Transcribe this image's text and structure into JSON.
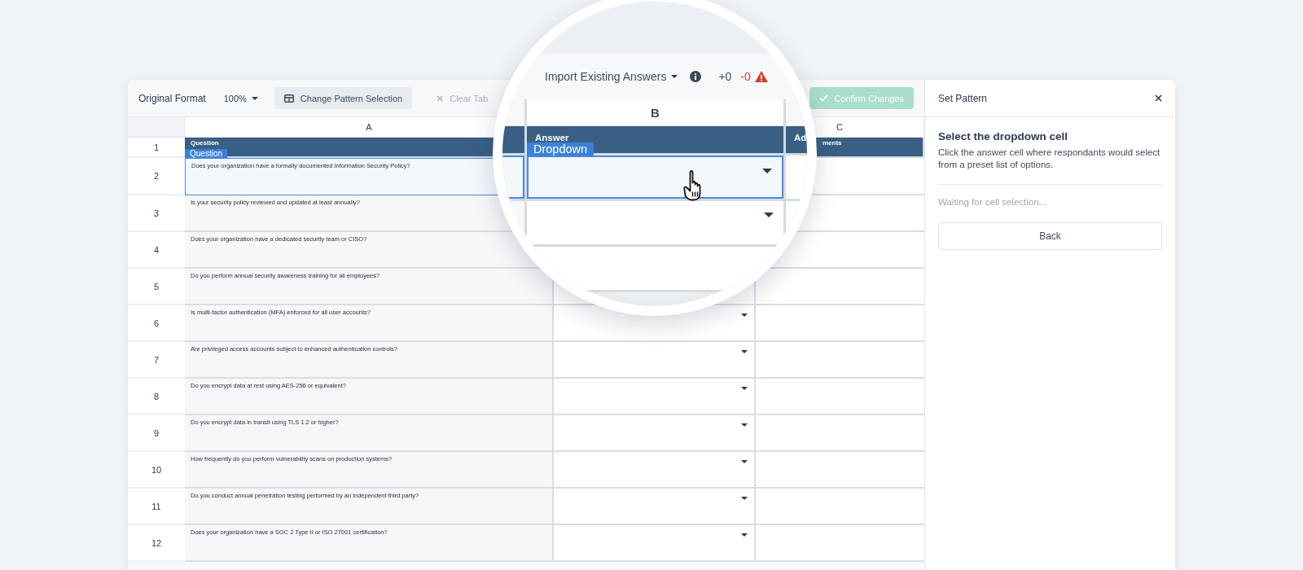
{
  "toolbar": {
    "format_label": "Original Format",
    "zoom": "100%",
    "change_pattern": "Change Pattern Selection",
    "clear_tab": "Clear Tab",
    "confirm": "Confirm Changes",
    "confirm_disabled": true,
    "clear_disabled": true
  },
  "columns": [
    "A",
    "C"
  ],
  "header_row": {
    "number": "1",
    "question_label": "Question",
    "question_tag": "Question",
    "comments_label": "ments"
  },
  "rows": [
    {
      "number": "2",
      "question": "Does your organization have a formally documented Information Security Policy?",
      "selected": true
    },
    {
      "number": "3",
      "question": "Is your security policy reviewed and updated at least annually?",
      "selected": false
    },
    {
      "number": "4",
      "question": "Does your organization have a dedicated security team or CISO?",
      "selected": false
    },
    {
      "number": "5",
      "question": "Do you perform annual security awareness training for all employees?",
      "selected": false
    },
    {
      "number": "6",
      "question": "Is multi-factor authentication (MFA) enforced for all user accounts?",
      "selected": false,
      "caret": true
    },
    {
      "number": "7",
      "question": "Are privileged access accounts subject to enhanced authentication controls?",
      "selected": false,
      "caret": true
    },
    {
      "number": "8",
      "question": "Do you encrypt data at rest using AES-256 or equivalent?",
      "selected": false,
      "caret": true
    },
    {
      "number": "9",
      "question": "Do you encrypt data in transit using TLS 1.2 or higher?",
      "selected": false,
      "caret": true
    },
    {
      "number": "10",
      "question": "How frequently do you perform vulnerability scans on production systems?",
      "selected": false,
      "caret": true
    },
    {
      "number": "11",
      "question": "Do you conduct annual penetration testing performed by an independent third party?",
      "selected": false,
      "caret": true
    },
    {
      "number": "12",
      "question": "Does your organization have a SOC 2 Type II or ISO 27001 certification?",
      "selected": false,
      "caret": true
    }
  ],
  "panel": {
    "title": "Set Pattern",
    "heading": "Select the dropdown cell",
    "description": "Click the answer cell where respondants would select from a preset list of options.",
    "status": "Waiting for cell selection...",
    "back": "Back"
  },
  "magnifier": {
    "import_label": "Import Existing Answers",
    "added": "+0",
    "removed": "-0",
    "column_letter": "B",
    "answer_label": "Answer",
    "answer_tag": "Dropdown",
    "next_label": "Ad",
    "rows": [
      {
        "selected": true,
        "caret": true
      },
      {
        "selected": false,
        "caret": true
      },
      {
        "selected": false
      }
    ]
  }
}
